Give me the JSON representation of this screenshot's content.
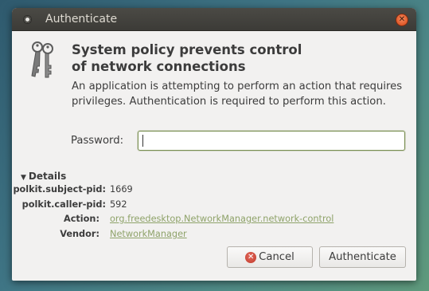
{
  "window": {
    "title": "Authenticate",
    "close_icon": "close-icon"
  },
  "dialog": {
    "heading_line1": "System policy prevents control",
    "heading_line2": "of network connections",
    "message": "An application is attempting to perform an action that requires privileges. Authentication is required to perform this action.",
    "icon": "keys-icon",
    "password_label": "Password:",
    "password_value": ""
  },
  "details": {
    "toggle_label": "Details",
    "rows": [
      {
        "key": "polkit.subject-pid:",
        "value": "1669",
        "link": false
      },
      {
        "key": "polkit.caller-pid:",
        "value": "592",
        "link": false
      },
      {
        "key": "Action:",
        "value": "org.freedesktop.NetworkManager.network-control",
        "link": true
      },
      {
        "key": "Vendor:",
        "value": "NetworkManager",
        "link": true
      }
    ]
  },
  "buttons": {
    "cancel_label": "Cancel",
    "authenticate_label": "Authenticate"
  },
  "colors": {
    "link": "#8fa36a",
    "titlebar": "#3c3b37",
    "close": "#e05a2a"
  }
}
